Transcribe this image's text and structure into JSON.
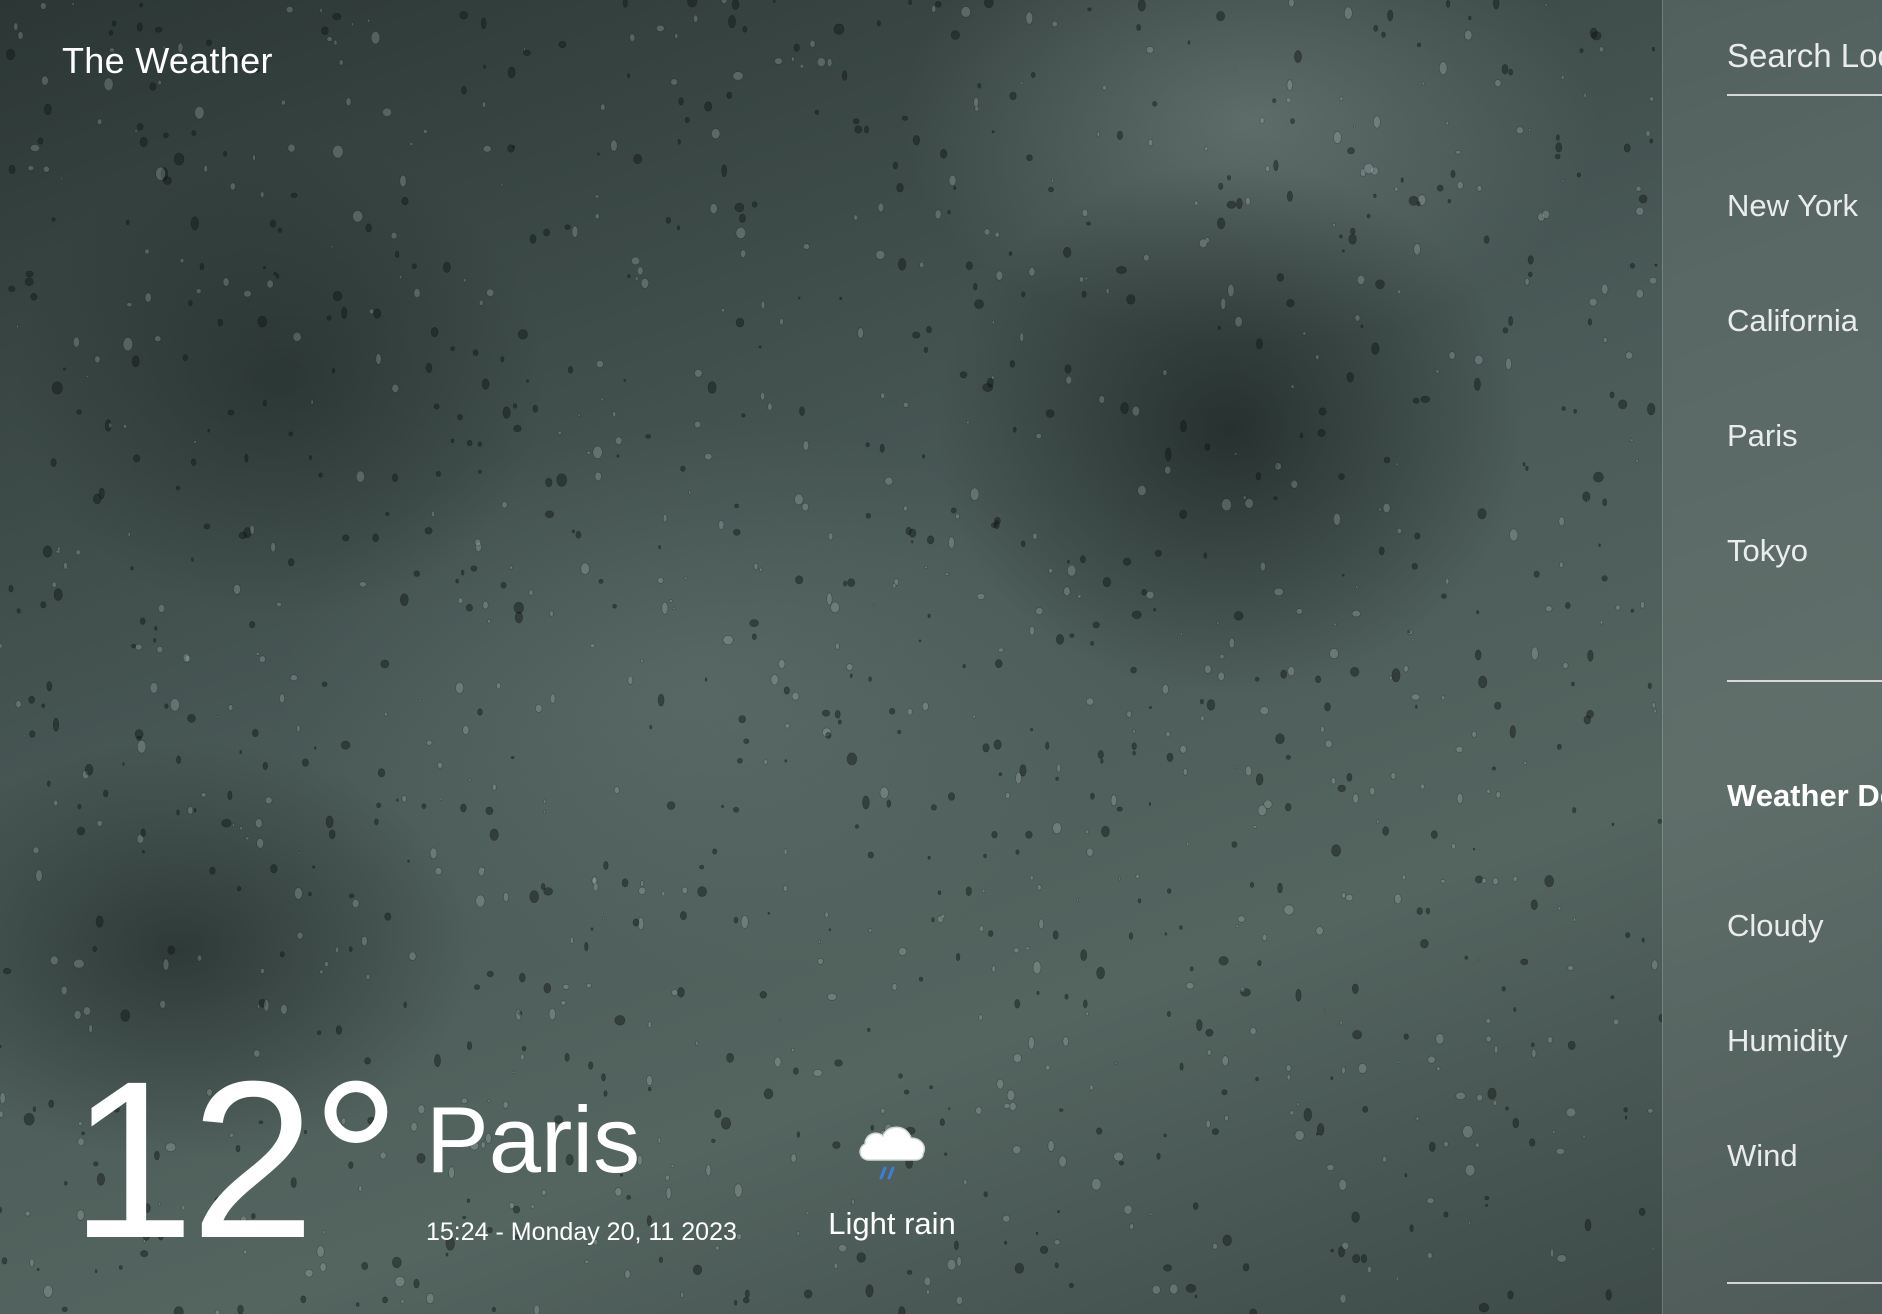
{
  "brand": "The Weather",
  "current": {
    "temperature": "12°",
    "city": "Paris",
    "datetime": "15:24 - Monday 20, 11 2023",
    "condition": "Light rain",
    "condition_icon": "cloud-rain-icon"
  },
  "sidebar": {
    "search_placeholder": "Search Location...",
    "search_value": "",
    "cities": [
      "New York",
      "California",
      "Paris",
      "Tokyo"
    ],
    "details_title": "Weather Details",
    "details": [
      {
        "label": "Cloudy"
      },
      {
        "label": "Humidity"
      },
      {
        "label": "Wind"
      }
    ]
  },
  "colors": {
    "text": "#ffffff",
    "rain_accent": "#3d7fd8",
    "background": "#4a5a57"
  }
}
